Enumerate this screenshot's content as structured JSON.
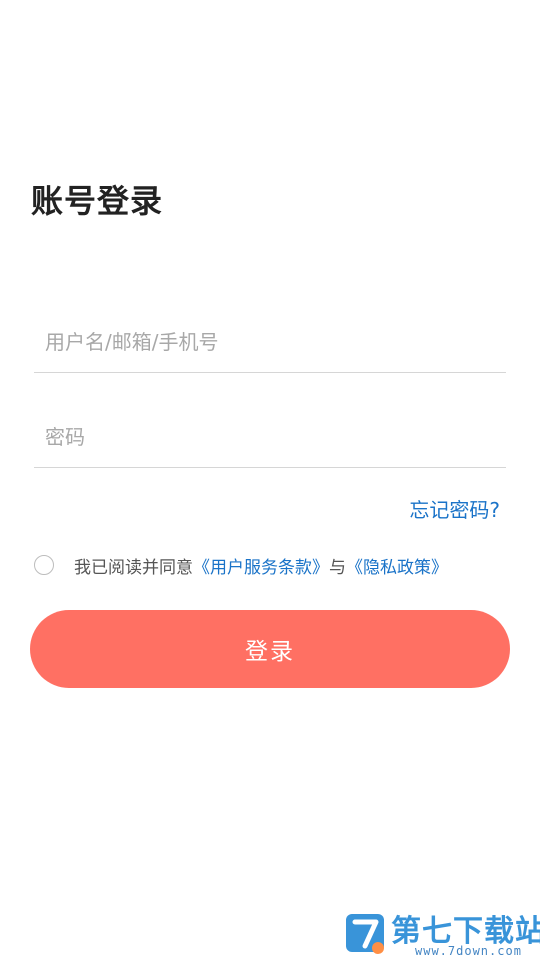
{
  "page": {
    "title": "账号登录"
  },
  "form": {
    "username_placeholder": "用户名/邮箱/手机号",
    "username_value": "",
    "password_placeholder": "密码",
    "password_value": ""
  },
  "forgot_password": "忘记密码?",
  "agreement": {
    "checked": false,
    "prefix": "我已阅读并同意",
    "terms_link": "《用户服务条款》",
    "conjunction": "与",
    "privacy_link": "《隐私政策》"
  },
  "login_button": "登录",
  "watermark": {
    "text": "第七下载站",
    "url": "www.7down.com"
  },
  "colors": {
    "accent": "#ff7063",
    "link": "#1a73c8",
    "watermark": "#2f8fd8"
  }
}
